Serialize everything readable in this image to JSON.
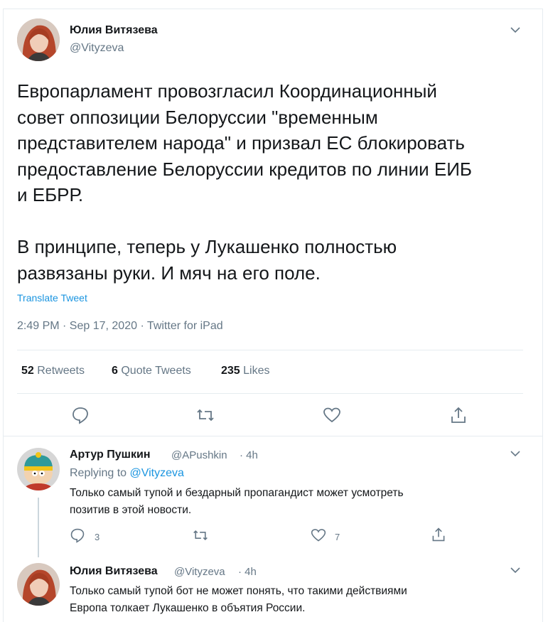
{
  "tweet": {
    "author_name": "Юлия Витязева",
    "author_handle": "@Vityzeva",
    "text_p1_l1": "Европарламент провозгласил Координационный",
    "text_p1_l2": "совет оппозиции Белоруссии \"временным",
    "text_p1_l3": "представителем народа\" и призвал ЕС блокировать",
    "text_p1_l4": "предоставление Белоруссии кредитов по линии ЕИБ",
    "text_p1_l5": "и ЕБРР.",
    "text_p2_l1": "В принципе, теперь у Лукашенко полностью",
    "text_p2_l2": "развязаны руки. И мяч на его поле.",
    "translate_label": "Translate Tweet",
    "timestamp": "2:49 PM · Sep 17, 2020 · Twitter for iPad",
    "retweets_count": "52",
    "retweets_label": "Retweets",
    "quotes_count": "6",
    "quotes_label": "Quote Tweets",
    "likes_count": "235",
    "likes_label": "Likes",
    "actions": [
      "reply-icon",
      "retweet-icon",
      "like-icon",
      "share-icon"
    ]
  },
  "reply1": {
    "author_name": "Артур Пушкин",
    "author_handle": "@APushkin",
    "time": "· 4h",
    "replying_prefix": "Replying to",
    "replying_handle": "@Vityzeva",
    "line1": "Только самый тупой и бездарный пропагандист может усмотреть",
    "line2": "позитив в этой новости.",
    "reply_count": "3",
    "like_count": "7"
  },
  "reply2": {
    "author_name": "Юлия Витязева",
    "author_handle": "@Vityzeva",
    "time": "· 4h",
    "line1": "Только самый тупой бот не может понять, что такими действиями",
    "line2": "Европа толкает Лукашенко в объятия России."
  },
  "colors": {
    "accent": "#1b95e0",
    "muted": "#657786",
    "divider": "#e6ecf0"
  }
}
